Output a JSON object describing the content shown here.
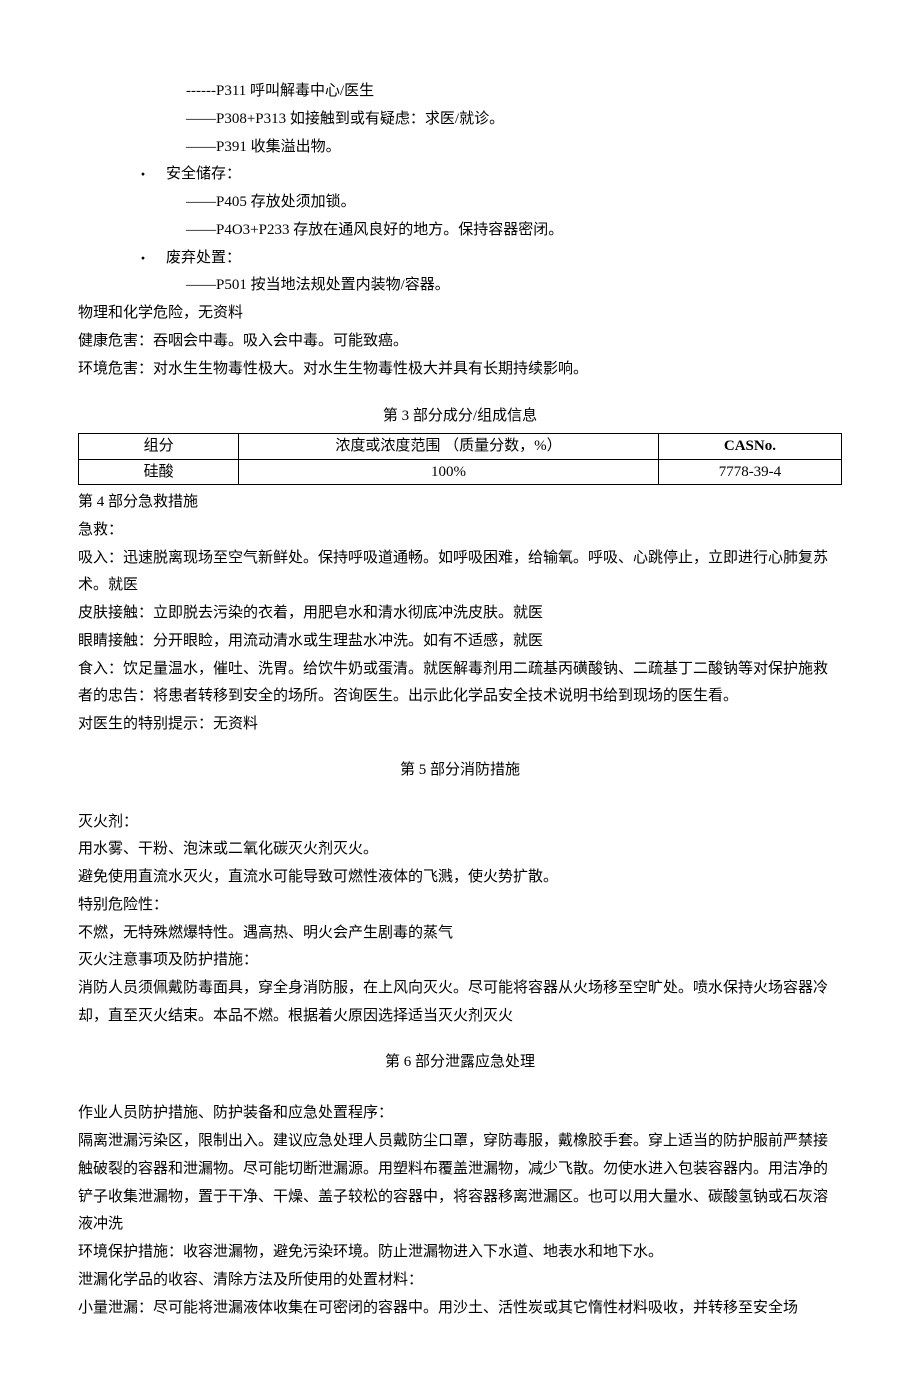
{
  "top": {
    "l1": "------P311 呼叫解毒中心/医生",
    "l2": "——P308+P313 如接触到或有疑虑：求医/就诊。",
    "l3": "——P391 收集溢出物。",
    "b1": "安全储存：",
    "l4": "——P405 存放处须加锁。",
    "l5": "——P4O3+P233 存放在通风良好的地方。保持容器密闭。",
    "b2": "废弃处置：",
    "l6": "——P501 按当地法规处置内装物/容器。",
    "phys": "物理和化学危险，无资料",
    "health": "健康危害：吞咽会中毒。吸入会中毒。可能致癌。",
    "env": "环境危害：对水生生物毒性极大。对水生生物毒性极大并具有长期持续影响。"
  },
  "sec3": {
    "title": "第 3 部分成分/组成信息",
    "h1": "组分",
    "h2": "浓度或浓度范围 （质量分数，%）",
    "h3": "CASNo.",
    "r1c1": "硅酸",
    "r1c2": "100%",
    "r1c3": "7778-39-4"
  },
  "sec4": {
    "title": "第 4 部分急救措施",
    "l1": "急救：",
    "l2": "吸入：迅速脱离现场至空气新鲜处。保持呼吸道通畅。如呼吸困难，给输氧。呼吸、心跳停止，立即进行心肺复苏术。就医",
    "l3": "皮肤接触：立即脱去污染的衣着，用肥皂水和清水彻底冲洗皮肤。就医",
    "l4": "眼睛接触：分开眼睑，用流动清水或生理盐水冲洗。如有不适感，就医",
    "l5": "食入：饮足量温水，催吐、洗胃。给饮牛奶或蛋清。就医解毒剂用二疏基丙磺酸钠、二疏基丁二酸钠等对保护施救者的忠告：将患者转移到安全的场所。咨询医生。出示此化学品安全技术说明书给到现场的医生看。",
    "l6": "对医生的特别提示：无资料"
  },
  "sec5": {
    "title": "第 5 部分消防措施",
    "l1": "灭火剂：",
    "l2": "用水雾、干粉、泡沫或二氧化碳灭火剂灭火。",
    "l3": "避免使用直流水灭火，直流水可能导致可燃性液体的飞溅，使火势扩散。",
    "l4": "特别危险性：",
    "l5": "不燃，无特殊燃爆特性。遇高热、明火会产生剧毒的蒸气",
    "l6": "灭火注意事项及防护措施：",
    "l7": "消防人员须佩戴防毒面具，穿全身消防服，在上风向灭火。尽可能将容器从火场移至空旷处。喷水保持火场容器冷却，直至灭火结束。本品不燃。根据着火原因选择适当灭火剂灭火"
  },
  "sec6": {
    "title": "第 6 部分泄露应急处理",
    "l1": "作业人员防护措施、防护装备和应急处置程序：",
    "l2": "隔离泄漏污染区，限制出入。建议应急处理人员戴防尘口罩，穿防毒服，戴橡胶手套。穿上适当的防护服前严禁接触破裂的容器和泄漏物。尽可能切断泄漏源。用塑料布覆盖泄漏物，减少飞散。勿使水进入包装容器内。用洁净的铲子收集泄漏物，置于干净、干燥、盖子较松的容器中，将容器移离泄漏区。也可以用大量水、碳酸氢钠或石灰溶液冲洗",
    "l3": "环境保护措施：收容泄漏物，避免污染环境。防止泄漏物进入下水道、地表水和地下水。",
    "l4": "泄漏化学品的收容、清除方法及所使用的处置材料：",
    "l5": "小量泄漏：尽可能将泄漏液体收集在可密闭的容器中。用沙土、活性炭或其它惰性材料吸收，并转移至安全场"
  }
}
